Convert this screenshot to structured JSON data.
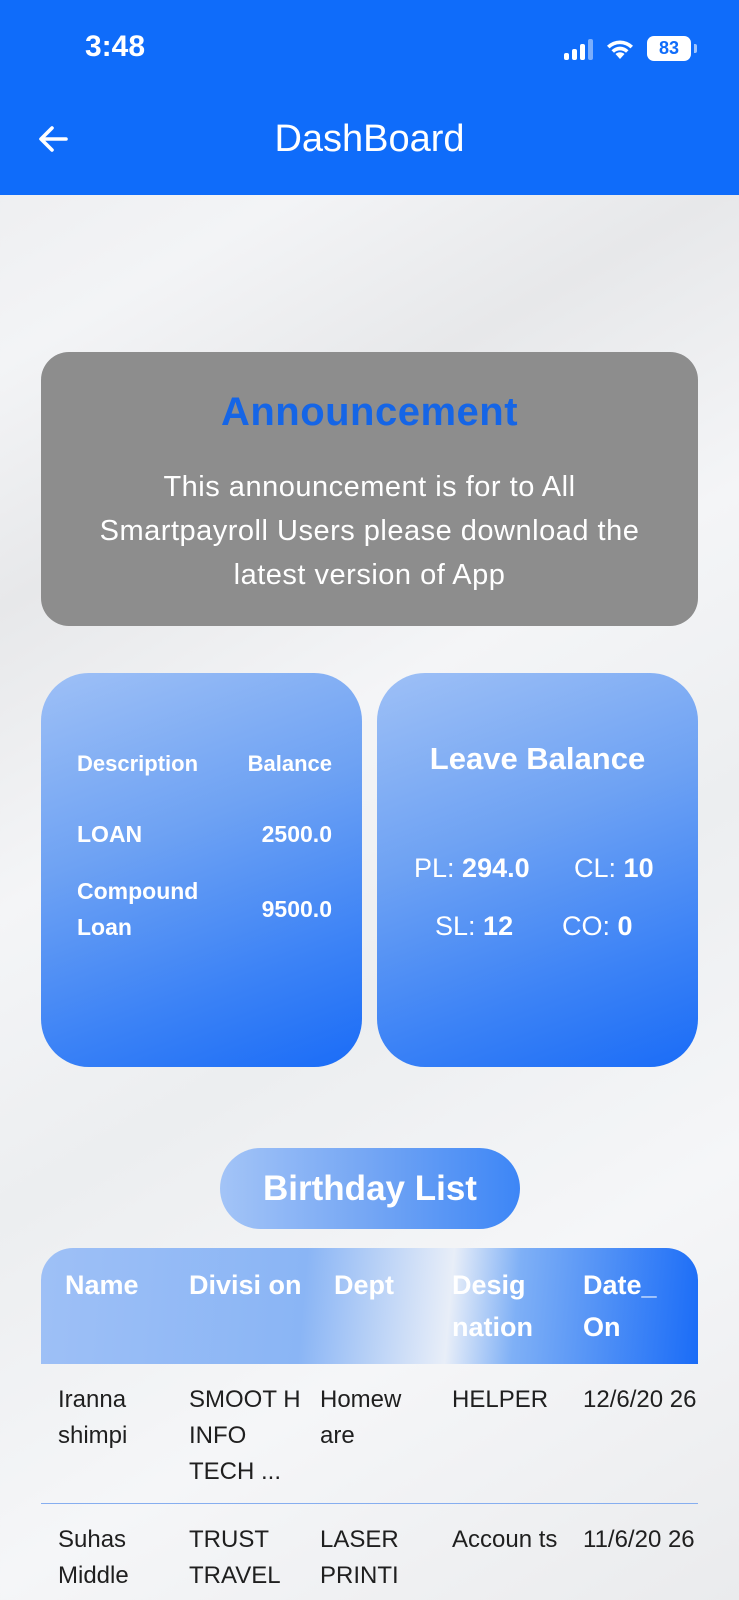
{
  "status_bar": {
    "time": "3:48",
    "battery": "83"
  },
  "header": {
    "title": "DashBoard"
  },
  "announcement": {
    "title": "Announcement",
    "message": "This announcement is for to All Smartpayroll Users please download the latest version of App"
  },
  "loan_card": {
    "col_description": "Description",
    "col_balance": "Balance",
    "rows": [
      {
        "description": "LOAN",
        "balance": "2500.0"
      },
      {
        "description": "Compound Loan",
        "balance": "9500.0"
      }
    ]
  },
  "leave_card": {
    "title": "Leave Balance",
    "pl_label": "PL:",
    "pl_value": "294.0",
    "cl_label": "CL:",
    "cl_value": "10",
    "sl_label": "SL:",
    "sl_value": "12",
    "co_label": "CO:",
    "co_value": "0"
  },
  "birthday": {
    "title": "Birthday List",
    "columns": [
      "Name",
      "Divisi on",
      "Dept",
      "Desig nation",
      "Date_ On"
    ],
    "rows": [
      [
        "Iranna shimpi",
        "SMOOT H INFO TECH ...",
        "Homew are",
        "HELPER",
        "12/6/20 26"
      ],
      [
        "Suhas Middle",
        "TRUST TRAVEL",
        "LASER PRINTI",
        "Accoun ts",
        "11/6/20 26"
      ]
    ]
  },
  "colors": {
    "primary": "#0f6cfa",
    "announcement_bg": "#8d8d8d",
    "announcement_title": "#1565e6"
  },
  "icons": {
    "back": "arrow-left-icon",
    "wifi": "wifi-icon",
    "signal": "signal-icon",
    "battery": "battery-icon"
  }
}
